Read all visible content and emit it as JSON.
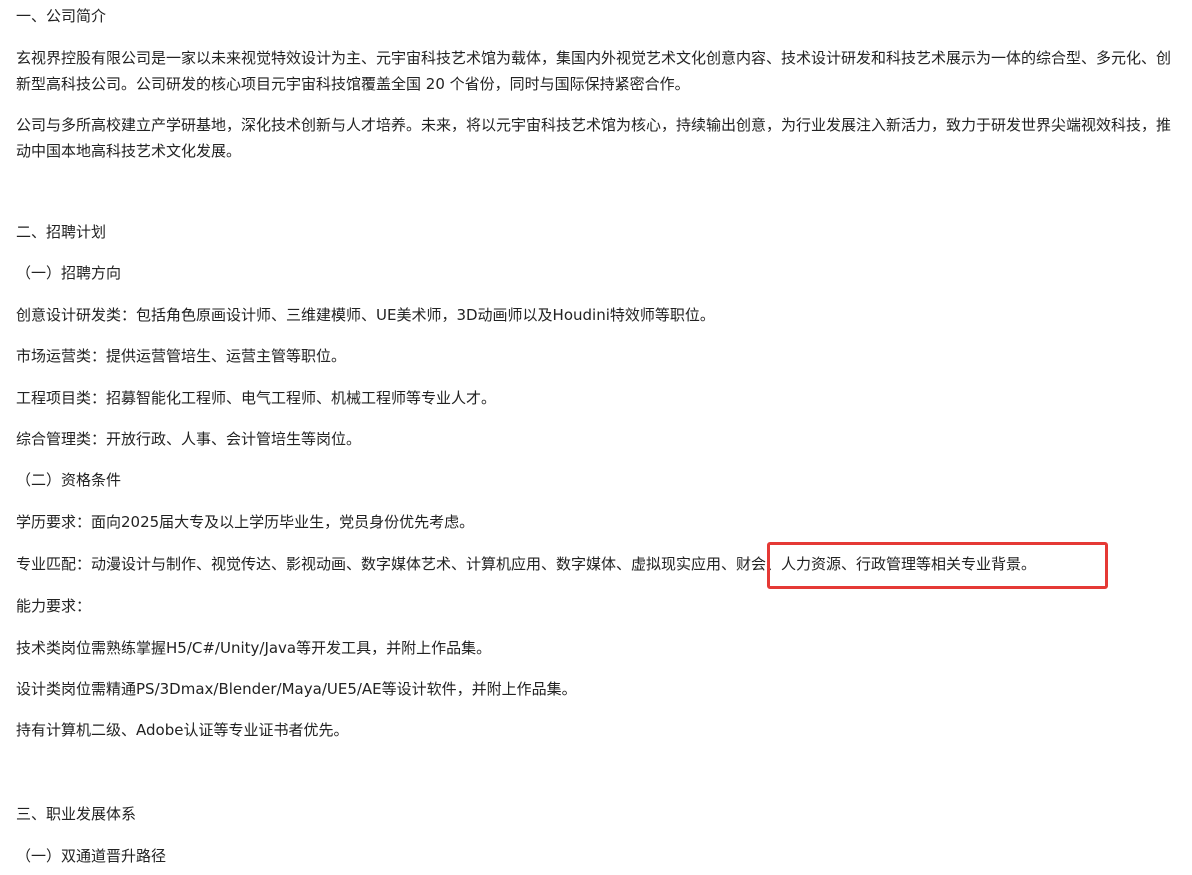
{
  "sections": {
    "intro_heading": "一、公司简介",
    "intro_p1": "玄视界控股有限公司是一家以未来视觉特效设计为主、元宇宙科技艺术馆为载体，集国内外视觉艺术文化创意内容、技术设计研发和科技艺术展示为一体的综合型、多元化、创新型高科技公司。公司研发的核心项目元宇宙科技馆覆盖全国 20 个省份，同时与国际保持紧密合作。",
    "intro_p2": "公司与多所高校建立产学研基地，深化技术创新与人才培养。未来，将以元宇宙科技艺术馆为核心，持续输出创意，为行业发展注入新活力，致力于研发世界尖端视效科技，推动中国本地高科技艺术文化发展。",
    "recruit_heading": "二、招聘计划",
    "direction_heading": "（一）招聘方向",
    "direction_items": [
      "创意设计研发类：包括角色原画设计师、三维建模师、UE美术师，3D动画师以及Houdini特效师等职位。",
      "市场运营类：提供运营管培生、运营主管等职位。",
      "工程项目类：招募智能化工程师、电气工程师、机械工程师等专业人才。",
      "综合管理类：开放行政、人事、会计管培生等岗位。"
    ],
    "qual_heading": "（二）资格条件",
    "education": "学历要求：面向2025届大专及以上学历毕业生，党员身份优先考虑。",
    "major_prefix": "专业匹配：动漫设计与制作、视觉传达、影视动画、数字媒体艺术、计算机应用、数字媒体、虚拟现实应用",
    "major_highlight": "、财会、人力资源、行政管理等相关专业背景。",
    "ability_heading": "能力要求：",
    "ability_items": [
      "技术类岗位需熟练掌握H5/C#/Unity/Java等开发工具，并附上作品集。",
      "设计类岗位需精通PS/3Dmax/Blender/Maya/UE5/AE等设计软件，并附上作品集。",
      "持有计算机二级、Adobe认证等专业证书者优先。"
    ],
    "career_heading": "三、职业发展体系",
    "dual_track_heading": "（一）双通道晋升路径"
  },
  "highlight_color": "#e53935"
}
